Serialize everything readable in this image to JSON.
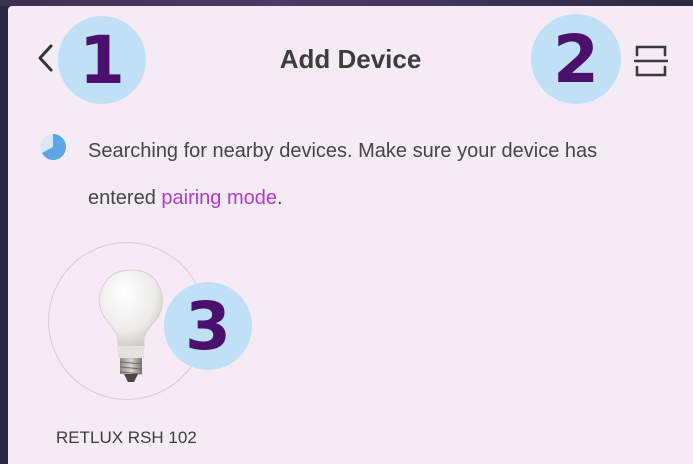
{
  "header": {
    "title": "Add Device",
    "back_icon": "chevron-left-icon",
    "scan_icon": "scan-icon"
  },
  "annotations": [
    "1",
    "2",
    "3"
  ],
  "status": {
    "text_before": "Searching for nearby devices. Make sure your device has entered ",
    "link_text": "pairing mode",
    "text_after": "."
  },
  "devices": [
    {
      "name": "RETLUX RSH 102",
      "icon": "light-bulb-icon"
    }
  ],
  "colors": {
    "background": "#f5ebf5",
    "accent_link": "#b13ad3",
    "badge_fill": "#bfe0f5",
    "badge_text": "#4b0f6e",
    "spinner": "#5aa6e6"
  }
}
